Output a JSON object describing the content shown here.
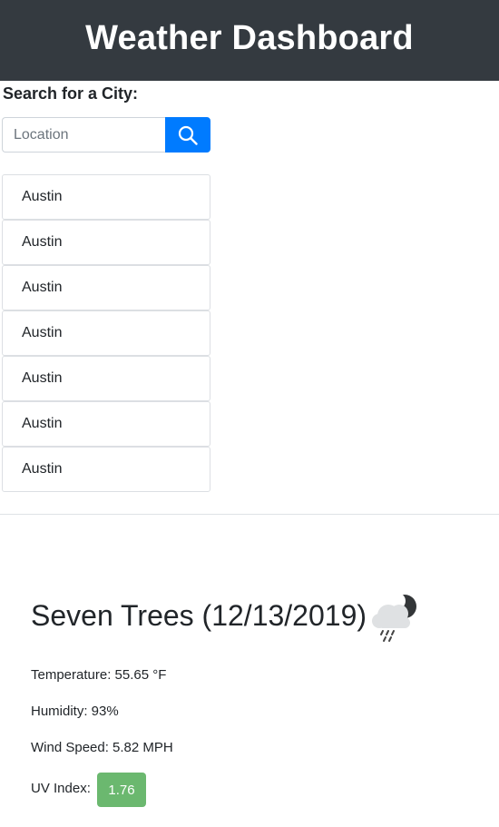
{
  "header": {
    "title": "Weather Dashboard"
  },
  "search": {
    "label": "Search for a City:",
    "placeholder": "Location",
    "value": "",
    "button_icon": "search-icon"
  },
  "history": {
    "cities": [
      "Austin",
      "Austin",
      "Austin",
      "Austin",
      "Austin",
      "Austin",
      "Austin"
    ]
  },
  "current": {
    "title": "Seven Trees (12/13/2019)",
    "icon": "rain-cloud-night-icon",
    "temperature": "Temperature: 55.65 °F",
    "humidity": "Humidity: 93%",
    "wind_speed": "Wind Speed: 5.82 MPH",
    "uv_label": "UV Index:",
    "uv_value": "1.76",
    "uv_color": "#6bb86f"
  },
  "colors": {
    "header_bg": "#343a40",
    "accent": "#007bff"
  }
}
